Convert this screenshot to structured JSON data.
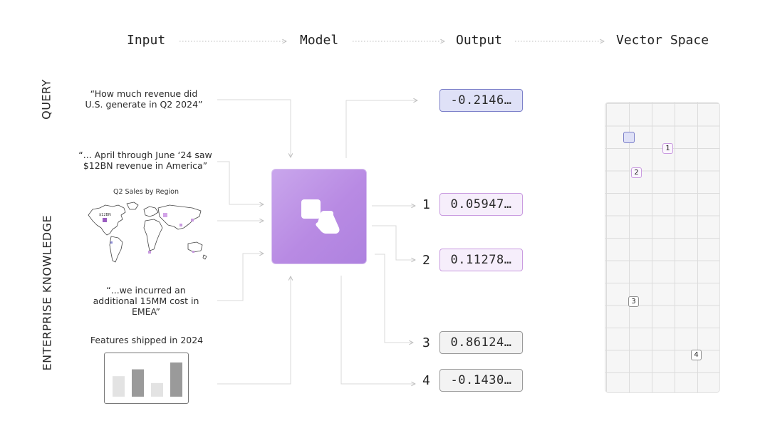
{
  "headers": {
    "input": "Input",
    "model": "Model",
    "output": "Output",
    "vector_space": "Vector Space"
  },
  "side_labels": {
    "query": "QUERY",
    "enterprise": "ENTERPRISE KNOWLEDGE"
  },
  "inputs": {
    "query_line1": "“How much revenue did",
    "query_line2": "U.S. generate in Q2 2024”",
    "doc1_line1": "“... April through June ‘24 saw",
    "doc1_line2": "$12BN revenue in America”",
    "map_title": "Q2 Sales by Region",
    "map_label": "$12BN",
    "doc3_line1": "“...we incurred an",
    "doc3_line2": "additional 15MM cost in",
    "doc3_line3": "EMEA”",
    "features_title": "Features shipped in 2024"
  },
  "outputs": {
    "query_value": "-0.2146…",
    "items": [
      {
        "num": "1",
        "value": "0.05947…"
      },
      {
        "num": "2",
        "value": "0.11278…"
      },
      {
        "num": "3",
        "value": "0.86124…"
      },
      {
        "num": "4",
        "value": "-0.1430…"
      }
    ]
  },
  "vector_tags": {
    "t1": "1",
    "t2": "2",
    "t3": "3",
    "t4": "4"
  },
  "features_chart": {
    "type": "bar",
    "values": [
      3,
      4,
      2,
      5
    ],
    "colors": [
      "#e3e3e3",
      "#9a9a9a",
      "#e3e3e3",
      "#9a9a9a"
    ]
  },
  "colors": {
    "query_accent": "#7c80c9",
    "knowledge_accent": "#c99be0",
    "model_fill": "#b88ae3"
  },
  "icons": {
    "model": "model-shapes-icon"
  }
}
